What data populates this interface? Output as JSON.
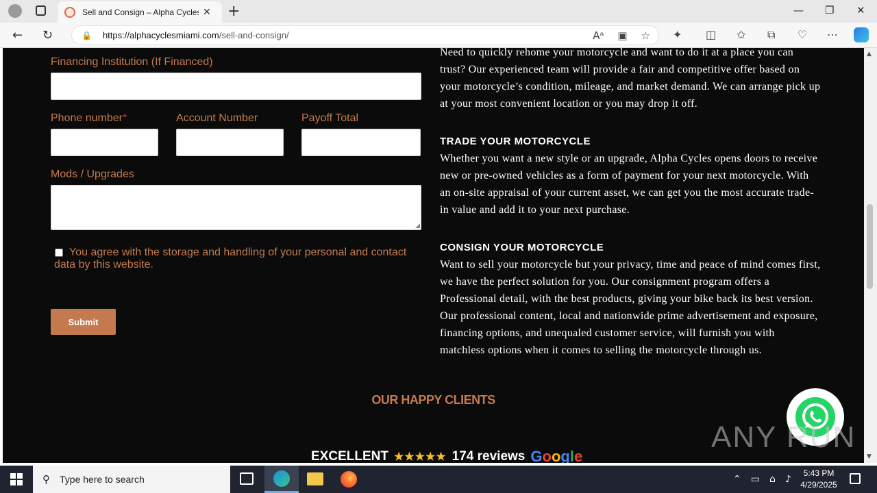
{
  "browser": {
    "tab_title": "Sell and Consign – Alpha Cycles",
    "url_host": "https://alphacyclesmiami.com",
    "url_path": "/sell-and-consign/"
  },
  "form": {
    "financing_label": "Financing Institution (If Financed)",
    "phone_label": "Phone number",
    "required_mark": "*",
    "account_label": "Account Number",
    "payoff_label": "Payoff Total",
    "mods_label": "Mods / Upgrades",
    "consent_text": "You agree with the storage and handling of your personal and contact data by this website.",
    "submit_label": "Submit"
  },
  "content": {
    "intro": "Need to quickly rehome your motorcycle and want to do it at a place you can trust? Our experienced team will provide a fair and competitive offer based on your motorcycle’s condition, mileage, and market demand. We can arrange pick up at your most convenient location or you may drop it off.",
    "trade_heading": "TRADE YOUR MOTORCYCLE",
    "trade_text": "Whether you want a new style or an upgrade, Alpha Cycles opens doors to receive new or pre-owned vehicles as a form of payment for your next motorcycle. With an on-site appraisal of your current asset, we can get you the most accurate trade-in value and add it to your next purchase.",
    "consign_heading": "CONSIGN YOUR MOTORCYCLE",
    "consign_text": "Want to sell your motorcycle but your privacy, time and peace of mind comes first, we have the perfect solution for you. Our consignment program offers a Professional detail, with the best products, giving your bike back its best version. Our professional content, local and nationwide prime advertisement and exposure, financing options, and unequaled customer service, will furnish you with matchless options when it comes to selling the motorcycle through us.",
    "happy_clients": "OUR HAPPY CLIENTS",
    "excellent": "EXCELLENT",
    "stars": "★★★★★",
    "reviews": "174 reviews",
    "google": [
      "G",
      "o",
      "o",
      "g",
      "l",
      "e"
    ]
  },
  "watermark": "ANY RUN",
  "taskbar": {
    "search_placeholder": "Type here to search",
    "time": "5:43 PM",
    "date": "4/29/2025"
  },
  "colors": {
    "accent": "#c47a4e",
    "page_bg": "#0b0b0b",
    "google": [
      "#4285f4",
      "#ea4335",
      "#fbbc05",
      "#4285f4",
      "#34a853",
      "#ea4335"
    ]
  }
}
